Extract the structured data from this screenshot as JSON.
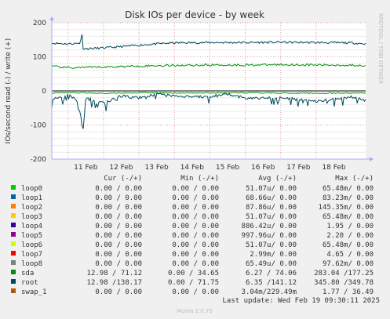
{
  "title": "Disk IOs per device - by week",
  "watermark": "RRDTOOL / TOBI OETIKER",
  "footer_update": "Last update: Wed Feb 19 09:30:11 2025",
  "footer_version": "Munin 2.0.75",
  "chart_data": {
    "type": "line",
    "title": "Disk IOs per device - by week",
    "ylabel": "IOs/second read (-) / write (+)",
    "ylim": [
      -200,
      200
    ],
    "yticks": [
      200,
      100,
      0,
      -100,
      -200
    ],
    "ytick_labels": [
      "200",
      "100",
      "0",
      "-100",
      "-200"
    ],
    "xlim": [
      "2025-02-10T13:00",
      "2025-02-19T09:30"
    ],
    "xticks": [
      "2025-02-11",
      "2025-02-12",
      "2025-02-13",
      "2025-02-14",
      "2025-02-15",
      "2025-02-16",
      "2025-02-17",
      "2025-02-18"
    ],
    "xtick_labels": [
      "11 Feb",
      "12 Feb",
      "13 Feb",
      "14 Feb",
      "15 Feb",
      "16 Feb",
      "17 Feb",
      "18 Feb"
    ],
    "grid": true,
    "colors": {
      "background": "#f0f0f0",
      "plot_bg": "#ffffff",
      "grid_major": "#e0a0a0",
      "zero_line": "#000000",
      "axis_arrow": "#aaaaff"
    },
    "series": [
      {
        "name": "root",
        "color": "#00495c",
        "write": {
          "x": [
            "2025-02-10T13:00",
            "2025-02-11T00:00",
            "2025-02-11T08:00",
            "2025-02-11T09:30",
            "2025-02-11T10:00",
            "2025-02-11T13:00",
            "2025-02-12T00:00",
            "2025-02-12T12:00",
            "2025-02-13T00:00",
            "2025-02-13T12:00",
            "2025-02-14T00:00",
            "2025-02-15T00:00",
            "2025-02-16T00:00",
            "2025-02-17T00:00",
            "2025-02-18T00:00",
            "2025-02-19T00:00",
            "2025-02-19T09:30"
          ],
          "y": [
            140,
            138,
            140,
            165,
            125,
            124,
            126,
            130,
            134,
            138,
            141,
            142,
            142,
            143,
            142,
            141,
            138
          ]
        },
        "read": {
          "x": [
            "2025-02-10T13:00",
            "2025-02-11T00:00",
            "2025-02-11T06:00",
            "2025-02-11T09:00",
            "2025-02-11T10:00",
            "2025-02-11T12:00",
            "2025-02-12T00:00",
            "2025-02-12T12:00",
            "2025-02-13T00:00",
            "2025-02-13T12:00",
            "2025-02-14T00:00",
            "2025-02-15T00:00",
            "2025-02-15T12:00",
            "2025-02-16T00:00",
            "2025-02-17T00:00",
            "2025-02-18T00:00",
            "2025-02-19T00:00",
            "2025-02-19T09:30"
          ],
          "y": [
            -25,
            -12,
            -28,
            -80,
            -128,
            -20,
            -35,
            -15,
            -20,
            -10,
            -15,
            -18,
            -8,
            -22,
            -20,
            -30,
            -18,
            -28
          ]
        }
      },
      {
        "name": "sda",
        "color": "#008f00",
        "write": {
          "x": [
            "2025-02-10T13:00",
            "2025-02-11T00:00",
            "2025-02-12T00:00",
            "2025-02-13T00:00",
            "2025-02-14T00:00",
            "2025-02-15T00:00",
            "2025-02-16T00:00",
            "2025-02-17T00:00",
            "2025-02-18T00:00",
            "2025-02-19T09:30"
          ],
          "y": [
            72,
            68,
            70,
            73,
            75,
            76,
            76,
            77,
            76,
            75
          ]
        },
        "read": {
          "x": [
            "2025-02-10T13:00",
            "2025-02-11T00:00",
            "2025-02-12T00:00",
            "2025-02-13T00:00",
            "2025-02-14T00:00",
            "2025-02-15T00:00",
            "2025-02-16T00:00",
            "2025-02-17T00:00",
            "2025-02-18T00:00",
            "2025-02-19T09:30"
          ],
          "y": [
            -6,
            -5,
            -7,
            -5,
            -6,
            -6,
            -5,
            -6,
            -7,
            -6
          ]
        }
      },
      {
        "name": "loop2",
        "color": "#ff8000",
        "write": {
          "x": [
            "2025-02-10T13:00",
            "2025-02-19T09:30"
          ],
          "y": [
            0,
            0
          ]
        }
      }
    ]
  },
  "legend": {
    "headers": [
      "Cur (-/+)",
      "Min (-/+)",
      "Avg (-/+)",
      "Max (-/+)"
    ],
    "rows": [
      {
        "name": "loop0",
        "color": "#00cc00",
        "cur": "0.00 /  0.00",
        "min": "0.00 /  0.00",
        "avg": "51.07u/  0.00",
        "max": "65.48m/  0.00"
      },
      {
        "name": "loop1",
        "color": "#0066b3",
        "cur": "0.00 /  0.00",
        "min": "0.00 /  0.00",
        "avg": "68.66u/  0.00",
        "max": "83.23m/  0.00"
      },
      {
        "name": "loop2",
        "color": "#ff8000",
        "cur": "0.00 /  0.00",
        "min": "0.00 /  0.00",
        "avg": "87.86u/  0.00",
        "max": "145.35m/  0.00"
      },
      {
        "name": "loop3",
        "color": "#ffcc00",
        "cur": "0.00 /  0.00",
        "min": "0.00 /  0.00",
        "avg": "51.07u/  0.00",
        "max": "65.48m/  0.00"
      },
      {
        "name": "loop4",
        "color": "#330099",
        "cur": "0.00 /  0.00",
        "min": "0.00 /  0.00",
        "avg": "886.42u/  0.00",
        "max": "1.95 /  0.00"
      },
      {
        "name": "loop5",
        "color": "#990099",
        "cur": "0.00 /  0.00",
        "min": "0.00 /  0.00",
        "avg": "997.96u/  0.00",
        "max": "2.20 /  0.00"
      },
      {
        "name": "loop6",
        "color": "#ccff00",
        "cur": "0.00 /  0.00",
        "min": "0.00 /  0.00",
        "avg": "51.07u/  0.00",
        "max": "65.48m/  0.00"
      },
      {
        "name": "loop7",
        "color": "#ff0000",
        "cur": "0.00 /  0.00",
        "min": "0.00 /  0.00",
        "avg": "2.99m/  0.00",
        "max": "4.65 /  0.00"
      },
      {
        "name": "loop8",
        "color": "#808080",
        "cur": "0.00 /  0.00",
        "min": "0.00 /  0.00",
        "avg": "65.49u/  0.00",
        "max": "97.62m/  0.00"
      },
      {
        "name": "sda",
        "color": "#008f00",
        "cur": "12.98 / 71.12",
        "min": "0.00 / 34.65",
        "avg": "6.27 / 74.06",
        "max": "283.04 /177.25"
      },
      {
        "name": "root",
        "color": "#00495c",
        "cur": "12.98 /138.17",
        "min": "0.00 / 71.75",
        "avg": "6.35 /141.12",
        "max": "345.80 /349.78"
      },
      {
        "name": "swap_1",
        "color": "#b35a00",
        "cur": "0.00 /  0.00",
        "min": "0.00 /  0.00",
        "avg": "3.04m/229.49m",
        "max": "1.77 / 36.49"
      }
    ]
  }
}
